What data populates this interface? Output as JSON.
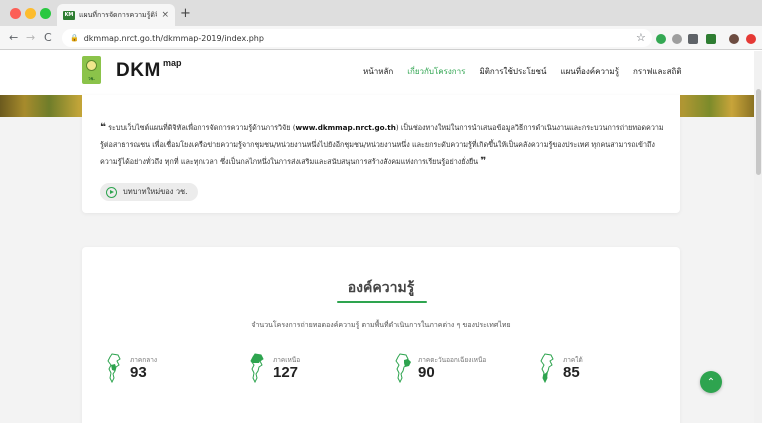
{
  "browser": {
    "tab_title": "แผนที่การจัดการความรู้ดิจิทัล::DK",
    "tab_favicon": "KM",
    "url": "dkmmap.nrct.go.th/dkmmap-2019/index.php"
  },
  "site": {
    "logo_main": "DKM",
    "logo_sup": "map",
    "logo_badge_text": "วช.",
    "nav": [
      "หน้าหลัก",
      "เกี่ยวกับโครงการ",
      "มิติการใช้ประโยชน์",
      "แผนที่องค์ความรู้",
      "กราฟและสถิติ"
    ],
    "nav_active_index": 1
  },
  "intro": {
    "quote_prefix": "ระบบเว็บไซต์แผนที่ดิจิทัลเพื่อการจัดการความรู้ด้านการวิจัย (",
    "quote_site": "www.dkmmap.nrct.go.th",
    "quote_suffix": ") เป็นช่องทางใหม่ในการนำเสนอข้อมูลวิธีการดำเนินงานและกระบวนการถ่ายทอดความรู้ต่อสาธารณชน เพื่อเชื่อมโยงเครือข่ายความรู้จากชุมชน/หน่วยงานหนึ่งไปยังอีกชุมชน/หน่วยงานหนึ่ง และยกระดับความรู้ที่เกิดขึ้นให้เป็นคลังความรู้ของประเทศ ทุกคนสามารถเข้าถึงความรู้ได้อย่างทั่วถึง ทุกที่ และทุกเวลา ซึ่งเป็นกลไกหนึ่งในการส่งเสริมและสนับสนุนการสร้างสังคมแห่งการเรียนรู้อย่างยั่งยืน",
    "video_button": "บทบาทใหม่ของ วช."
  },
  "knowledge": {
    "title": "องค์ความรู้",
    "subtitle": "จำนวนโครงการถ่ายทอดองค์ความรู้ ตามพื้นที่ดำเนินการในภาคต่าง ๆ ของประเทศไทย",
    "regions": [
      {
        "label": "ภาคกลาง",
        "count": "93",
        "icon": "thailand-central-map-icon"
      },
      {
        "label": "ภาคเหนือ",
        "count": "127",
        "icon": "thailand-north-map-icon"
      },
      {
        "label": "ภาคตะวันออกเฉียงเหนือ",
        "count": "90",
        "icon": "thailand-northeast-map-icon"
      },
      {
        "label": "ภาคใต้",
        "count": "85",
        "icon": "thailand-south-map-icon"
      }
    ]
  },
  "colors": {
    "accent": "#2ea44f",
    "logo_red": "#e53935"
  }
}
